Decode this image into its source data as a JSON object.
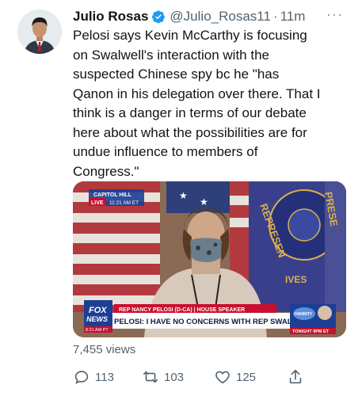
{
  "tweet": {
    "author_name": "Julio Rosas",
    "handle": "@Julio_Rosas11",
    "separator": "·",
    "time": "11m",
    "more_label": "···",
    "text": "Pelosi says Kevin McCarthy is focusing\non Swalwell's interaction with the\nsuspected Chinese spy bc he \"has\nQanon in his delegation over there. That I\nthink is a danger in terms of our debate\nhere about what the possibilities are for\nundue influence to members of\nCongress.\""
  },
  "media": {
    "location_label": "CAPITOL HILL",
    "live_label": "LIVE",
    "clock_label": "11:21 AM ET",
    "lower_third_label": "REP NANCY PELOSI (D-CA) | HOUSE SPEAKER",
    "headline": "PELOSI: I HAVE NO CONCERNS WITH REP SWALWELL",
    "network_label_1": "FOX",
    "network_label_2": "NEWS",
    "network_time": "8:21 AM PT",
    "promo_label": "TONIGHT 9PM ET",
    "promo_logo_text": "HANNITY",
    "seal_text_1": "REPRESEN",
    "seal_text_2": "PRESE",
    "seal_text_3": "IVES"
  },
  "stats": {
    "views": "7,455 views"
  },
  "actions": {
    "reply_count": "113",
    "retweet_count": "103",
    "like_count": "125"
  },
  "colors": {
    "verified": "#1d9bf0",
    "text_secondary": "#536471",
    "fox_red": "#c8102e",
    "fox_blue": "#1c3f94"
  },
  "icons": [
    "verified-badge-icon",
    "more-icon",
    "reply-icon",
    "retweet-icon",
    "like-icon",
    "share-icon"
  ]
}
